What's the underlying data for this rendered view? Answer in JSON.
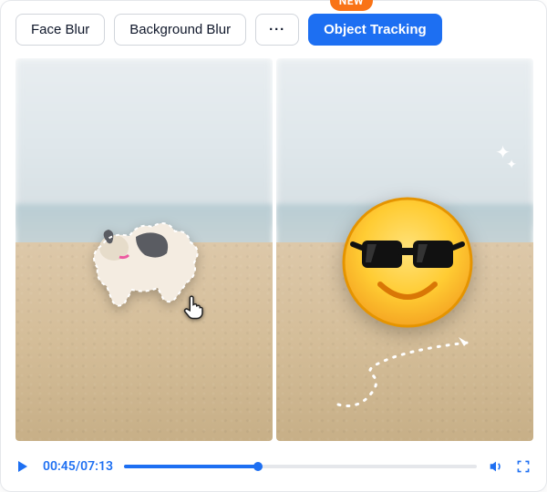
{
  "badge": {
    "new": "NEW"
  },
  "tabs": {
    "face_blur": "Face Blur",
    "background_blur": "Background Blur",
    "more": "···",
    "object_tracking": "Object Tracking"
  },
  "preview": {
    "left": {
      "subject": "dog-running",
      "selection_active": true,
      "cursor": "hand-pointer"
    },
    "right": {
      "overlay": "sunglasses-emoji",
      "sparkle": true,
      "motion_arrow": true
    }
  },
  "player": {
    "state": "paused",
    "current_time": "00:45",
    "duration": "07:13",
    "separator": "/",
    "progress_percent": 38,
    "volume_icon": "volume",
    "fullscreen_icon": "fullscreen"
  },
  "colors": {
    "accent": "#1d6ff2",
    "badge": "#f97316"
  }
}
